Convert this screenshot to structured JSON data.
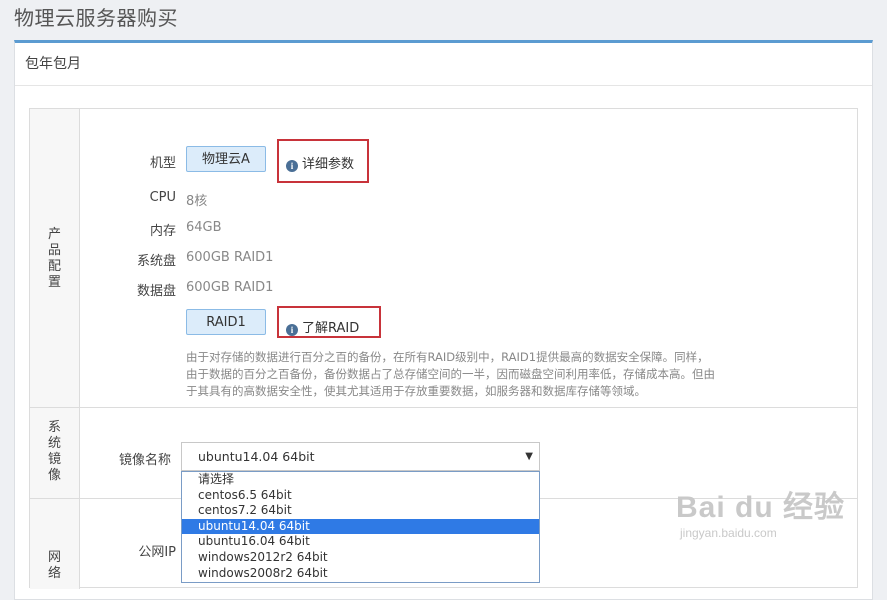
{
  "page_title": "物理云服务器购买",
  "panel": {
    "title": "包年包月"
  },
  "sections": {
    "product_config": [
      "产",
      "品",
      "配",
      "置"
    ],
    "system_image": [
      "系",
      "统",
      "镜",
      "像"
    ],
    "network": [
      "网",
      "络"
    ]
  },
  "product": {
    "model_label": "机型",
    "model_value": "物理云A",
    "detail_link": "详细参数",
    "cpu_label": "CPU",
    "cpu_value": "8核",
    "memory_label": "内存",
    "memory_value": "64GB",
    "system_disk_label": "系统盘",
    "system_disk_value": "600GB RAID1",
    "data_disk_label": "数据盘",
    "data_disk_value": "600GB RAID1",
    "raid_button": "RAID1",
    "raid_link": "了解RAID",
    "raid_desc": [
      "由于对存储的数据进行百分之百的备份，在所有RAID级别中，RAID1提供最高的数据安全保障。同样，",
      "由于数据的百分之百备份，备份数据占了总存储空间的一半，因而磁盘空间利用率低，存储成本高。但由",
      "于其具有的高数据安全性，使其尤其适用于存放重要数据，如服务器和数据库存储等领域。"
    ]
  },
  "image": {
    "label": "镜像名称",
    "selected": "ubuntu14.04 64bit",
    "options": [
      "请选择",
      "centos6.5 64bit",
      "centos7.2 64bit",
      "ubuntu14.04 64bit",
      "ubuntu16.04 64bit",
      "windows2012r2 64bit",
      "windows2008r2 64bit"
    ]
  },
  "network": {
    "public_ip_label": "公网IP"
  },
  "watermark": {
    "main": "Bai du 经验",
    "sub": "jingyan.baidu.com"
  },
  "colors": {
    "accent": "#5b9bd1",
    "highlight": "#c8333a",
    "selected_option": "#2f7ae5"
  }
}
